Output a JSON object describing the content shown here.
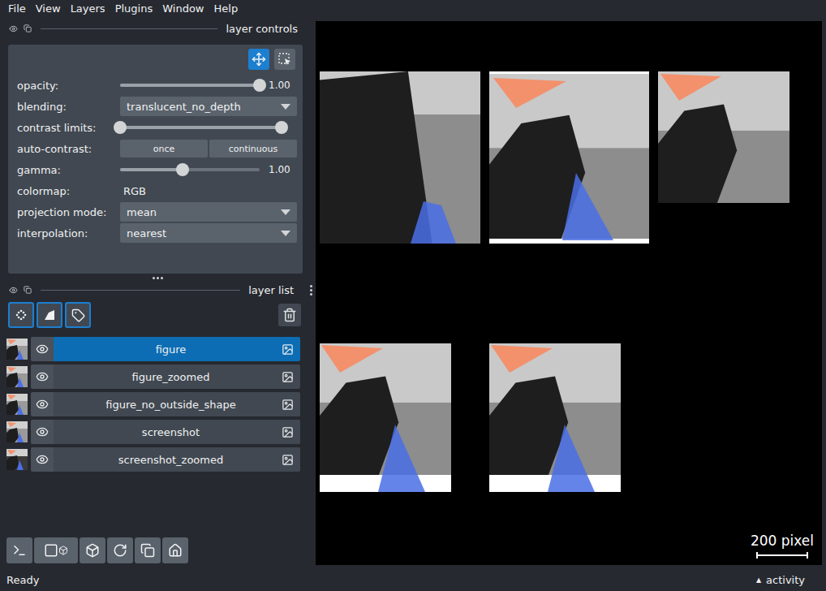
{
  "menu": [
    "File",
    "View",
    "Layers",
    "Plugins",
    "Window",
    "Help"
  ],
  "layer_controls": {
    "title": "layer controls",
    "modes": [
      {
        "selected": true
      },
      {
        "selected": false
      }
    ],
    "controls": [
      {
        "kind": "slider",
        "label": "opacity:",
        "level": 1,
        "reading": "1.00"
      },
      {
        "kind": "dropdown",
        "label": "blending:",
        "value": "translucent_no_depth"
      },
      {
        "kind": "range",
        "label": "contrast limits:",
        "low": 0,
        "high": 1
      },
      {
        "kind": "buttons",
        "label": "auto-contrast:",
        "buttons": [
          "once",
          "continuous"
        ]
      },
      {
        "kind": "slider",
        "label": "gamma:",
        "level": 0.45,
        "reading": "1.00"
      },
      {
        "kind": "text",
        "label": "colormap:",
        "value": "RGB"
      },
      {
        "kind": "dropdown",
        "label": "projection mode:",
        "value": "mean"
      },
      {
        "kind": "dropdown",
        "label": "interpolation:",
        "value": "nearest"
      }
    ]
  },
  "layer_list": {
    "title": "layer list",
    "layers": [
      {
        "name": "figure",
        "selected": true,
        "visible": true
      },
      {
        "name": "figure_zoomed",
        "selected": false,
        "visible": true
      },
      {
        "name": "figure_no_outside_shape",
        "selected": false,
        "visible": true
      },
      {
        "name": "screenshot",
        "selected": false,
        "visible": true
      },
      {
        "name": "screenshot_zoomed",
        "selected": false,
        "visible": true
      }
    ]
  },
  "canvas": {
    "scale_bar": "200 pixel"
  },
  "status_bar": {
    "message": "Ready",
    "activity_icon": "▲",
    "activity": "activity"
  }
}
